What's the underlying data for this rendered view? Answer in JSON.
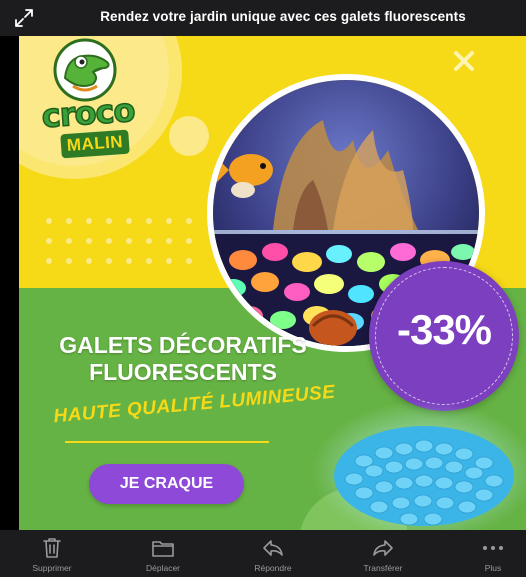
{
  "header": {
    "title": "Rendez votre jardin unique avec ces galets fluorescents",
    "expand_icon": "expand-arrows-icon"
  },
  "ad": {
    "brand_line1": "croco",
    "brand_line2": "MALIN",
    "discount": "-33%",
    "headline_line1": "GALETS DÉCORATIFS",
    "headline_line2": "FLUORESCENTS",
    "tagline": "HAUTE QUALITÉ LUMINEUSE",
    "cta_label": "JE CRAQUE",
    "colors": {
      "yellow": "#f6d917",
      "green": "#66b345",
      "purple": "#8e49d8",
      "badge": "#7b3fbf"
    }
  },
  "toolbar": {
    "items": [
      {
        "label": "Supprimer",
        "icon": "trash-icon"
      },
      {
        "label": "Déplacer",
        "icon": "folder-icon"
      },
      {
        "label": "Répondre",
        "icon": "reply-icon"
      },
      {
        "label": "Transférer",
        "icon": "forward-icon"
      },
      {
        "label": "Plus",
        "icon": "more-icon"
      }
    ]
  }
}
